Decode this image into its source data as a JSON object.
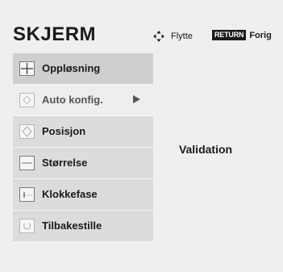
{
  "header": {
    "title": "SKJERM",
    "hint_move_label": "Flytte",
    "return_key": "RETURN",
    "return_label": "Forig"
  },
  "menu": {
    "items": [
      {
        "label": "Oppløsning",
        "icon": "resolution-crosshair-icon"
      },
      {
        "label": "Auto konfig.",
        "icon": "auto-config-icon",
        "has_submenu": true
      },
      {
        "label": "Posisjon",
        "icon": "position-icon"
      },
      {
        "label": "Størrelse",
        "icon": "size-icon"
      },
      {
        "label": "Klokkefase",
        "icon": "clock-phase-icon"
      },
      {
        "label": "Tilbakestille",
        "icon": "reset-icon"
      }
    ]
  },
  "detail": {
    "text": "Validation"
  },
  "colors": {
    "panel_bg": "#efefef",
    "item_bg": "#dcdcdc",
    "selected_item_bg": "#cfcfcf",
    "active_item_bg": "#eeeeee",
    "text": "#1a1a1a"
  }
}
